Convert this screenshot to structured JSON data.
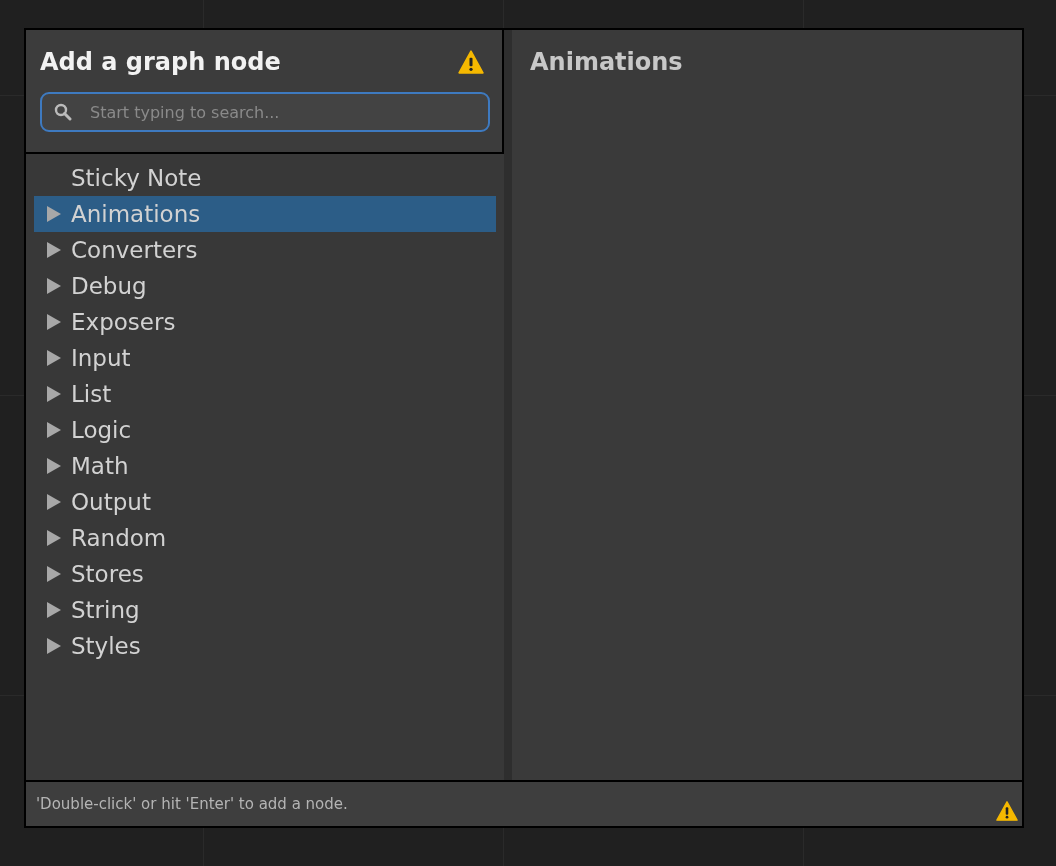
{
  "dialog": {
    "title": "Add a graph node",
    "search": {
      "placeholder": "Start typing to search..."
    },
    "items": [
      {
        "label": "Sticky Note",
        "kind": "leaf",
        "selected": false
      },
      {
        "label": "Animations",
        "kind": "category",
        "selected": true
      },
      {
        "label": "Converters",
        "kind": "category",
        "selected": false
      },
      {
        "label": "Debug",
        "kind": "category",
        "selected": false
      },
      {
        "label": "Exposers",
        "kind": "category",
        "selected": false
      },
      {
        "label": "Input",
        "kind": "category",
        "selected": false
      },
      {
        "label": "List",
        "kind": "category",
        "selected": false
      },
      {
        "label": "Logic",
        "kind": "category",
        "selected": false
      },
      {
        "label": "Math",
        "kind": "category",
        "selected": false
      },
      {
        "label": "Output",
        "kind": "category",
        "selected": false
      },
      {
        "label": "Random",
        "kind": "category",
        "selected": false
      },
      {
        "label": "Stores",
        "kind": "category",
        "selected": false
      },
      {
        "label": "String",
        "kind": "category",
        "selected": false
      },
      {
        "label": "Styles",
        "kind": "category",
        "selected": false
      }
    ],
    "detail": {
      "title": "Animations"
    },
    "status_bar": {
      "hint": "'Double-click' or hit 'Enter' to add a node."
    }
  }
}
